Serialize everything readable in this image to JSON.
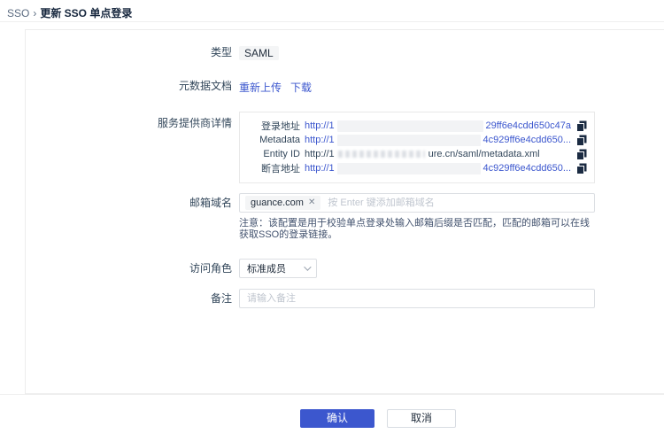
{
  "breadcrumb": {
    "root": "SSO",
    "separator": "›",
    "current": "更新 SSO 单点登录"
  },
  "colors": {
    "accent": "#3C57CE",
    "text_dark": "#1F2B3A",
    "text_label": "#33475B",
    "border": "#ECECEC",
    "copy_icon": "#1B2B42",
    "redaction": "#F2F3F5"
  },
  "form": {
    "type": {
      "label": "类型",
      "value": "SAML"
    },
    "metadata_doc": {
      "label": "元数据文档",
      "reupload_label": "重新上传",
      "download_label": "下载"
    },
    "sp_details": {
      "label": "服务提供商详情",
      "rows": [
        {
          "name": "登录地址",
          "prefix": "http://1",
          "suffix": "29ff6e4cdd650c47a"
        },
        {
          "name": "Metadata",
          "prefix": "http://1",
          "suffix": "4c929ff6e4cdd650..."
        },
        {
          "name": "Entity ID",
          "prefix": "http://1",
          "suffix": "ure.cn/saml/metadata.xml"
        },
        {
          "name": "断言地址",
          "prefix": "http://1",
          "suffix": "4c929ff6e4cdd650..."
        }
      ]
    },
    "email_domain": {
      "label": "邮箱域名",
      "tag": "guance.com",
      "remove_icon": "✕",
      "placeholder": "按 Enter 键添加邮箱域名",
      "note": "注意：该配置是用于校验单点登录处输入邮箱后缀是否匹配，匹配的邮箱可以在线获取SSO的登录链接。"
    },
    "access_role": {
      "label": "访问角色",
      "value": "标准成员"
    },
    "remark": {
      "label": "备注",
      "placeholder": "请输入备注"
    }
  },
  "footer": {
    "confirm_label": "确认",
    "cancel_label": "取消"
  }
}
